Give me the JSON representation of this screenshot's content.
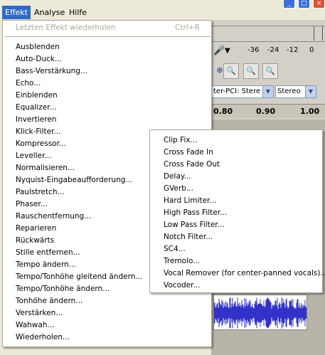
{
  "menubar": {
    "items": [
      {
        "label": "Effekt",
        "active": true
      },
      {
        "label": "Analyse",
        "active": false
      },
      {
        "label": "Hilfe",
        "active": false
      }
    ]
  },
  "effekt_menu": {
    "repeat_last": {
      "label": "Letzten Effekt wiederholen",
      "shortcut": "Ctrl+R",
      "enabled": false
    },
    "items": [
      "Ausblenden",
      "Auto-Duck...",
      "Bass-Verstärkung...",
      "Echo...",
      "Einblenden",
      "Equalizer...",
      "Invertieren",
      "Klick-Filter...",
      "Kompressor...",
      "Leveller...",
      "Normalisieren...",
      "Nyquist-Eingabeaufforderung...",
      "Paulstretch...",
      "Phaser...",
      "Rauschentfernung...",
      "Reparieren",
      "Rückwärts",
      "Stille entfernen...",
      "Tempo ändern...",
      "Tempo/Tonhöhe gleitend ändern...",
      "Tempo/Tonhöhe ändern...",
      "Tonhöhe ändern...",
      "Verstärken...",
      "Wahwah...",
      "Wiederholen..."
    ]
  },
  "plugins_submenu": {
    "items": [
      "Clip Fix...",
      "Cross Fade In",
      "Cross Fade Out",
      "Delay...",
      "GVerb...",
      "Hard Limiter...",
      "High Pass Filter...",
      "Low Pass Filter...",
      "Notch Filter...",
      "SC4...",
      "Tremolo...",
      "Vocal Remover (for center-panned vocals)...",
      "Vocoder..."
    ]
  },
  "meter": {
    "labels": [
      "-36",
      "-24",
      "-12",
      "0"
    ]
  },
  "device_select": {
    "value": "ter-PCI: Stere"
  },
  "channel_select": {
    "value": "Stereo"
  },
  "ruler": {
    "ticks": [
      "0.80",
      "0.90",
      "1.00"
    ]
  },
  "colors": {
    "highlight": "#316ac5",
    "waveform": "#3232c8",
    "disabled_text": "#aca899"
  }
}
